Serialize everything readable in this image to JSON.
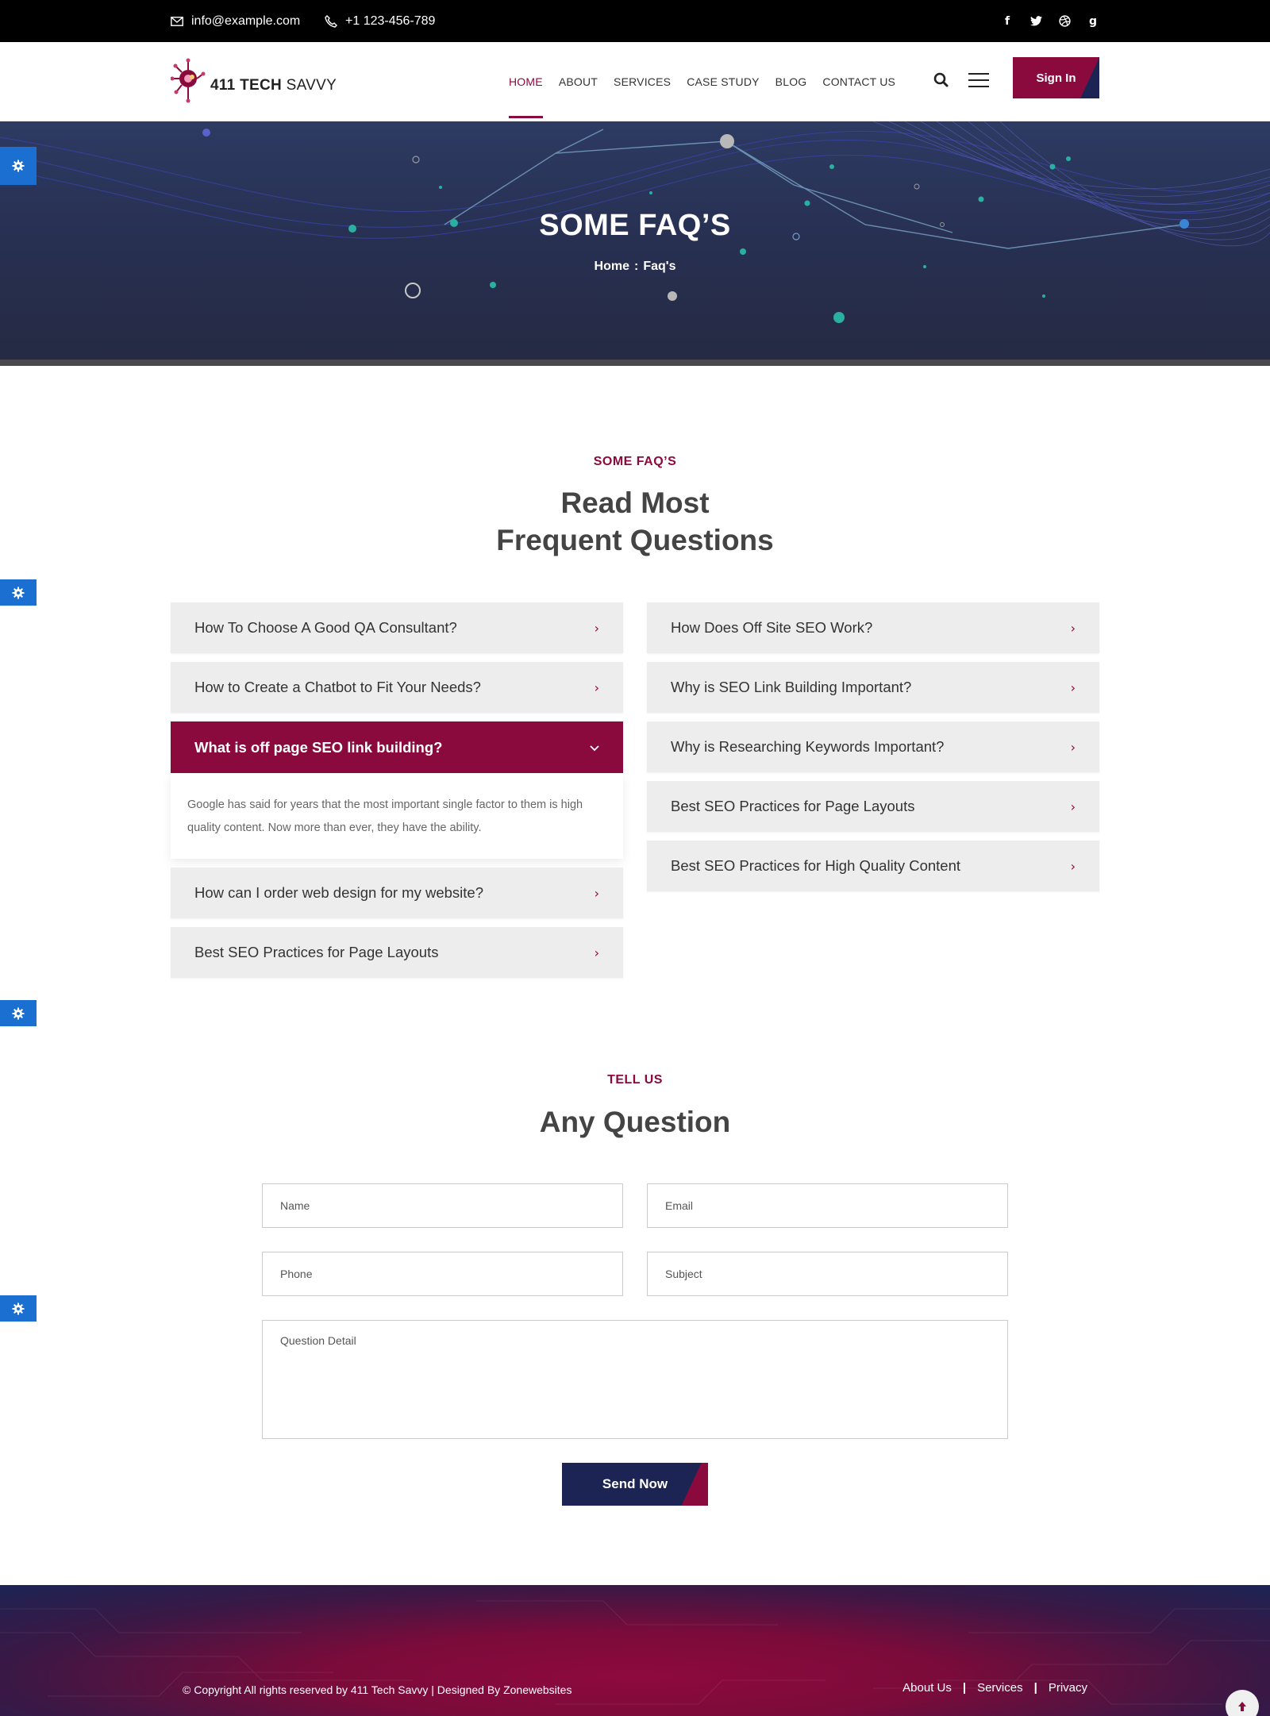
{
  "topbar": {
    "email": "info@example.com",
    "phone": "+1 123-456-789",
    "social": [
      {
        "icon": "facebook-icon",
        "glyph": "f"
      },
      {
        "icon": "twitter-icon",
        "glyph": "t"
      },
      {
        "icon": "dribbble-icon",
        "glyph": "◍"
      },
      {
        "icon": "google-icon",
        "glyph": "g"
      }
    ]
  },
  "header": {
    "logo_bold": "411 TECH",
    "logo_light": " SAVVY",
    "nav": [
      "HOME",
      "ABOUT",
      "SERVICES",
      "CASE STUDY",
      "BLOG",
      "CONTACT US"
    ],
    "active_nav": "HOME",
    "signin_label": "Sign In"
  },
  "hero": {
    "title": "SOME FAQ’S",
    "breadcrumb_home": "Home",
    "breadcrumb_sep": ":",
    "breadcrumb_current": "Faq's"
  },
  "faq": {
    "label": "SOME FAQ’S",
    "title_line1": "Read Most",
    "title_line2": "Frequent Questions",
    "left": [
      {
        "q": "How To Choose A Good QA Consultant?",
        "open": false
      },
      {
        "q": "How to Create a Chatbot to Fit Your Needs?",
        "open": false
      },
      {
        "q": "What is off page SEO link building?",
        "open": true,
        "answer": "Google has said for years that the most important single factor to them is high quality content. Now more than ever, they have the ability."
      },
      {
        "q": "How can I order web design for my website?",
        "open": false
      },
      {
        "q": "Best SEO Practices for Page Layouts",
        "open": false
      }
    ],
    "right": [
      {
        "q": "How Does Off Site SEO Work?",
        "open": false
      },
      {
        "q": "Why is SEO Link Building Important?",
        "open": false
      },
      {
        "q": "Why is Researching Keywords Important?",
        "open": false
      },
      {
        "q": "Best SEO Practices for Page Layouts",
        "open": false
      },
      {
        "q": "Best SEO Practices for High Quality Content",
        "open": false
      }
    ]
  },
  "form": {
    "label": "TELL US",
    "title": "Any Question",
    "name_placeholder": "Name",
    "email_placeholder": "Email",
    "phone_placeholder": "Phone",
    "subject_placeholder": "Subject",
    "detail_placeholder": "Question Detail",
    "send_label": "Send Now"
  },
  "footer": {
    "copyright": "© Copyright All rights reserved by 411 Tech Savvy | Designed By Zonewebsites",
    "links": [
      "About Us",
      "Services",
      "Privacy"
    ],
    "link_separator": "|"
  },
  "colors": {
    "brand": "#8b0a3e",
    "navy": "#1c2454",
    "side_tab": "#1a6fd1"
  }
}
